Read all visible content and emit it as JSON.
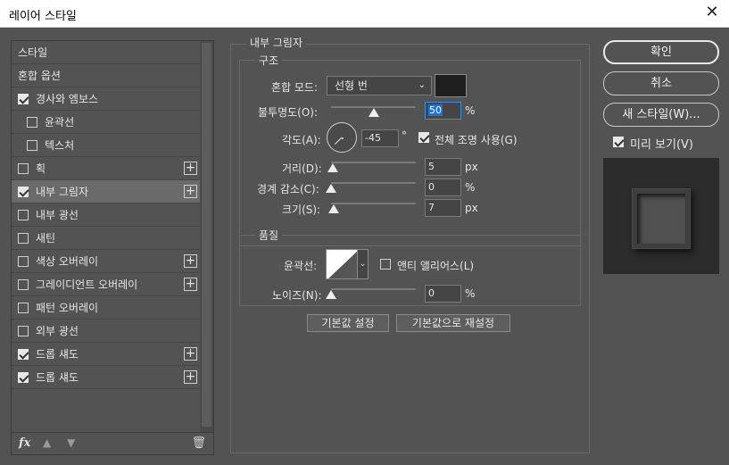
{
  "window": {
    "title": "레이어 스타일",
    "close_icon": "close-icon"
  },
  "styles_list": {
    "items": [
      {
        "label": "스타일",
        "checkbox": false,
        "checked": false,
        "plus": false,
        "indent": false,
        "selected": false
      },
      {
        "label": "혼합 옵션",
        "checkbox": false,
        "checked": false,
        "plus": false,
        "indent": false,
        "selected": false
      },
      {
        "label": "경사와 엠보스",
        "checkbox": true,
        "checked": true,
        "plus": false,
        "indent": false,
        "selected": false
      },
      {
        "label": "윤곽선",
        "checkbox": true,
        "checked": false,
        "plus": false,
        "indent": true,
        "selected": false
      },
      {
        "label": "텍스처",
        "checkbox": true,
        "checked": false,
        "plus": false,
        "indent": true,
        "selected": false
      },
      {
        "label": "획",
        "checkbox": true,
        "checked": false,
        "plus": true,
        "indent": false,
        "selected": false
      },
      {
        "label": "내부 그림자",
        "checkbox": true,
        "checked": true,
        "plus": true,
        "indent": false,
        "selected": true
      },
      {
        "label": "내부 광선",
        "checkbox": true,
        "checked": false,
        "plus": false,
        "indent": false,
        "selected": false
      },
      {
        "label": "새틴",
        "checkbox": true,
        "checked": false,
        "plus": false,
        "indent": false,
        "selected": false
      },
      {
        "label": "색상 오버레이",
        "checkbox": true,
        "checked": false,
        "plus": true,
        "indent": false,
        "selected": false
      },
      {
        "label": "그레이디언트 오버레이",
        "checkbox": true,
        "checked": false,
        "plus": true,
        "indent": false,
        "selected": false
      },
      {
        "label": "패턴 오버레이",
        "checkbox": true,
        "checked": false,
        "plus": false,
        "indent": false,
        "selected": false
      },
      {
        "label": "외부 광선",
        "checkbox": true,
        "checked": false,
        "plus": false,
        "indent": false,
        "selected": false
      },
      {
        "label": "드롭 섀도",
        "checkbox": true,
        "checked": true,
        "plus": true,
        "indent": false,
        "selected": false
      },
      {
        "label": "드롭 섀도",
        "checkbox": true,
        "checked": true,
        "plus": true,
        "indent": false,
        "selected": false
      }
    ],
    "footer": {
      "fx": "fx",
      "fx_icon": "fx-icon",
      "up_icon": "move-up-icon",
      "down_icon": "move-down-icon",
      "trash_icon": "trash-icon"
    }
  },
  "inner_shadow": {
    "section_title": "내부 그림자",
    "structure": {
      "legend": "구조",
      "blend_mode_label": "혼합 모드:",
      "blend_mode_value": "선형 번",
      "shadow_color": "#1f1f1f",
      "opacity_label": "불투명도(O):",
      "opacity_value": "50",
      "opacity_unit": "%",
      "opacity_slider": 0.5,
      "angle_label": "각도(A):",
      "angle_value": "-45",
      "angle_unit": "°",
      "global_light_label": "전체 조명 사용(G)",
      "global_light_checked": true,
      "distance_label": "거리(D):",
      "distance_value": "5",
      "distance_unit": "px",
      "distance_slider": 0.02,
      "choke_label": "경계 감소(C):",
      "choke_value": "0",
      "choke_unit": "%",
      "choke_slider": 0.0,
      "size_label": "크기(S):",
      "size_value": "7",
      "size_unit": "px",
      "size_slider": 0.03
    },
    "quality": {
      "legend": "품질",
      "contour_label": "윤곽선:",
      "antialias_label": "앤티 앨리어스(L)",
      "antialias_checked": false,
      "noise_label": "노이즈(N):",
      "noise_value": "0",
      "noise_unit": "%",
      "noise_slider": 0.0
    },
    "make_default": "기본값 설정",
    "reset_default": "기본값으로 재설정"
  },
  "right_panel": {
    "ok": "확인",
    "cancel": "취소",
    "new_style": "새 스타일(W)...",
    "preview_label": "미리 보기(V)",
    "preview_checked": true
  }
}
